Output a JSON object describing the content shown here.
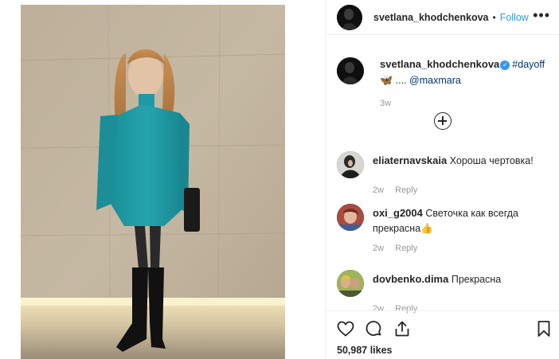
{
  "header": {
    "username": "svetlana_khodchenkova",
    "separator": "•",
    "follow_label": "Follow",
    "more_label": "•••"
  },
  "caption": {
    "username": "svetlana_khodchenkova",
    "hashtag": "#dayoff",
    "emoji": "🦋",
    "ellipsis": " .... ",
    "mention": "@maxmara",
    "time": "3w"
  },
  "comments": [
    {
      "username": "eliaternavskaia",
      "text": "Хороша чертовка!",
      "time": "2w",
      "reply_label": "Reply"
    },
    {
      "username": "oxi_g2004",
      "text": "Светочка как всегда прекрасна👍",
      "time": "2w",
      "reply_label": "Reply"
    },
    {
      "username": "dovbenko.dima",
      "text": "Прекрасна",
      "time": "2w",
      "reply_label": "Reply"
    }
  ],
  "likes": "50,987 likes",
  "icons": {
    "like": "heart-icon",
    "comment": "comment-icon",
    "share": "share-icon",
    "save": "bookmark-icon",
    "load_more": "plus-circle-icon"
  },
  "colors": {
    "link": "#3897f0",
    "tag": "#003569",
    "muted": "#999999",
    "verified": "#3897f0"
  }
}
